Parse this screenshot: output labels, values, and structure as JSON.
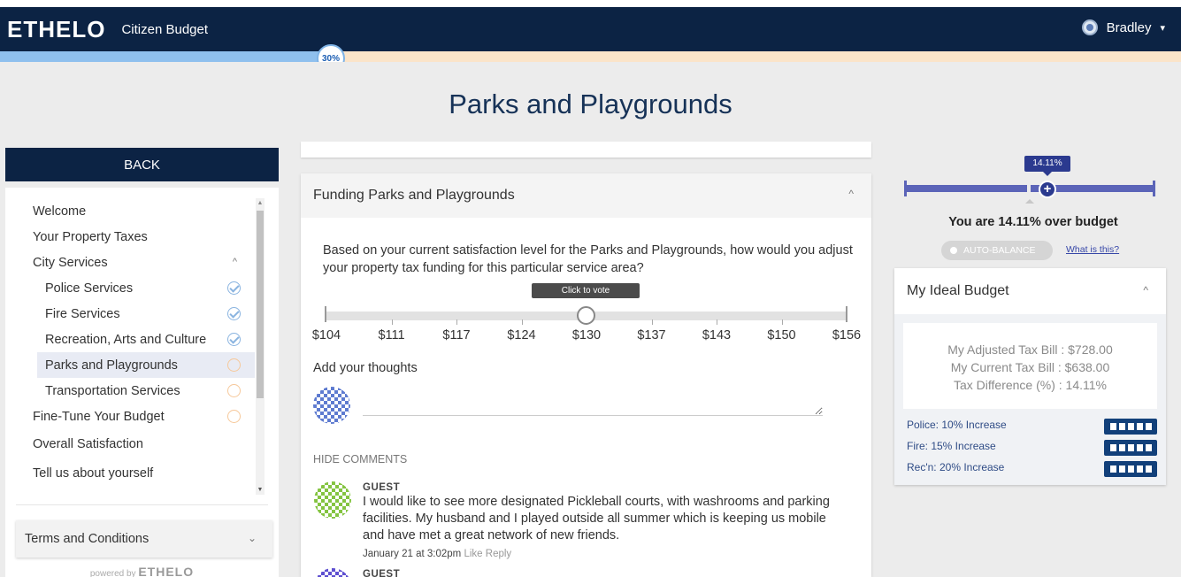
{
  "header": {
    "logo": "ETHELO",
    "app_title": "Citizen Budget",
    "user_name": "Bradley",
    "user_caret": "▾"
  },
  "progress": {
    "percent_label": "30%",
    "fraction": 0.27
  },
  "page_title": "Parks and Playgrounds",
  "sidebar": {
    "back_label": "BACK",
    "items": [
      {
        "label": "Welcome"
      },
      {
        "label": "Your Property Taxes"
      },
      {
        "label": "City Services",
        "caret": "^"
      },
      {
        "label": "Police Services",
        "status": "done"
      },
      {
        "label": "Fire Services",
        "status": "done"
      },
      {
        "label": "Recreation, Arts and Culture",
        "status": "done"
      },
      {
        "label": "Parks and Playgrounds",
        "status": "todo"
      },
      {
        "label": "Transportation Services",
        "status": "todo"
      },
      {
        "label": "Fine-Tune Your Budget",
        "status": "todo"
      },
      {
        "label": "Overall Satisfaction"
      },
      {
        "label": "Tell us about yourself"
      }
    ],
    "terms_label": "Terms and Conditions",
    "powered_prefix": "powered by",
    "powered_brand": "ETHELO"
  },
  "question_card": {
    "title": "Funding Parks and Playgrounds",
    "question": "Based on your current satisfaction level for the Parks and Playgrounds, how would you adjust your property tax funding for this particular service area?",
    "tooltip": "Click to vote",
    "slider_labels": [
      "$104",
      "$111",
      "$117",
      "$124",
      "$130",
      "$137",
      "$143",
      "$150",
      "$156"
    ],
    "slider_value": "$130",
    "thoughts_label": "Add your thoughts",
    "thoughts_placeholder": "",
    "hide_comments": "HIDE COMMENTS",
    "comments": [
      {
        "author": "GUEST",
        "text": "I would like to see more designated Pickleball courts, with washrooms and parking facilities. My husband and I played outside all summer which is keeping us mobile and have met a great network of new friends.",
        "date": "January 21 at 3:02pm",
        "like": "Like",
        "reply": "Reply"
      },
      {
        "author": "GUEST"
      }
    ]
  },
  "budget_meter": {
    "value_label": "14.11%",
    "status": "You are 14.11% over budget",
    "auto_balance": "AUTO-BALANCE",
    "what_is_this": "What is this?",
    "fill_fraction": 0.56
  },
  "ideal_budget": {
    "title": "My Ideal Budget",
    "adjusted": "My Adjusted Tax Bill : $728.00",
    "current": "My Current Tax Bill : $638.00",
    "difference": "Tax Difference (%) : 14.11%",
    "increases": [
      {
        "label": "Police: 10% Increase",
        "level": 5
      },
      {
        "label": "Fire: 15% Increase",
        "level": 5
      },
      {
        "label": "Rec'n: 20% Increase",
        "level": 5
      }
    ]
  },
  "colors": {
    "navy": "#0c2344",
    "progress_fill": "#8fc0ee",
    "progress_track": "#fbe4c9",
    "budget_accent": "#2b3a8f",
    "increase_bar": "#12407a"
  }
}
